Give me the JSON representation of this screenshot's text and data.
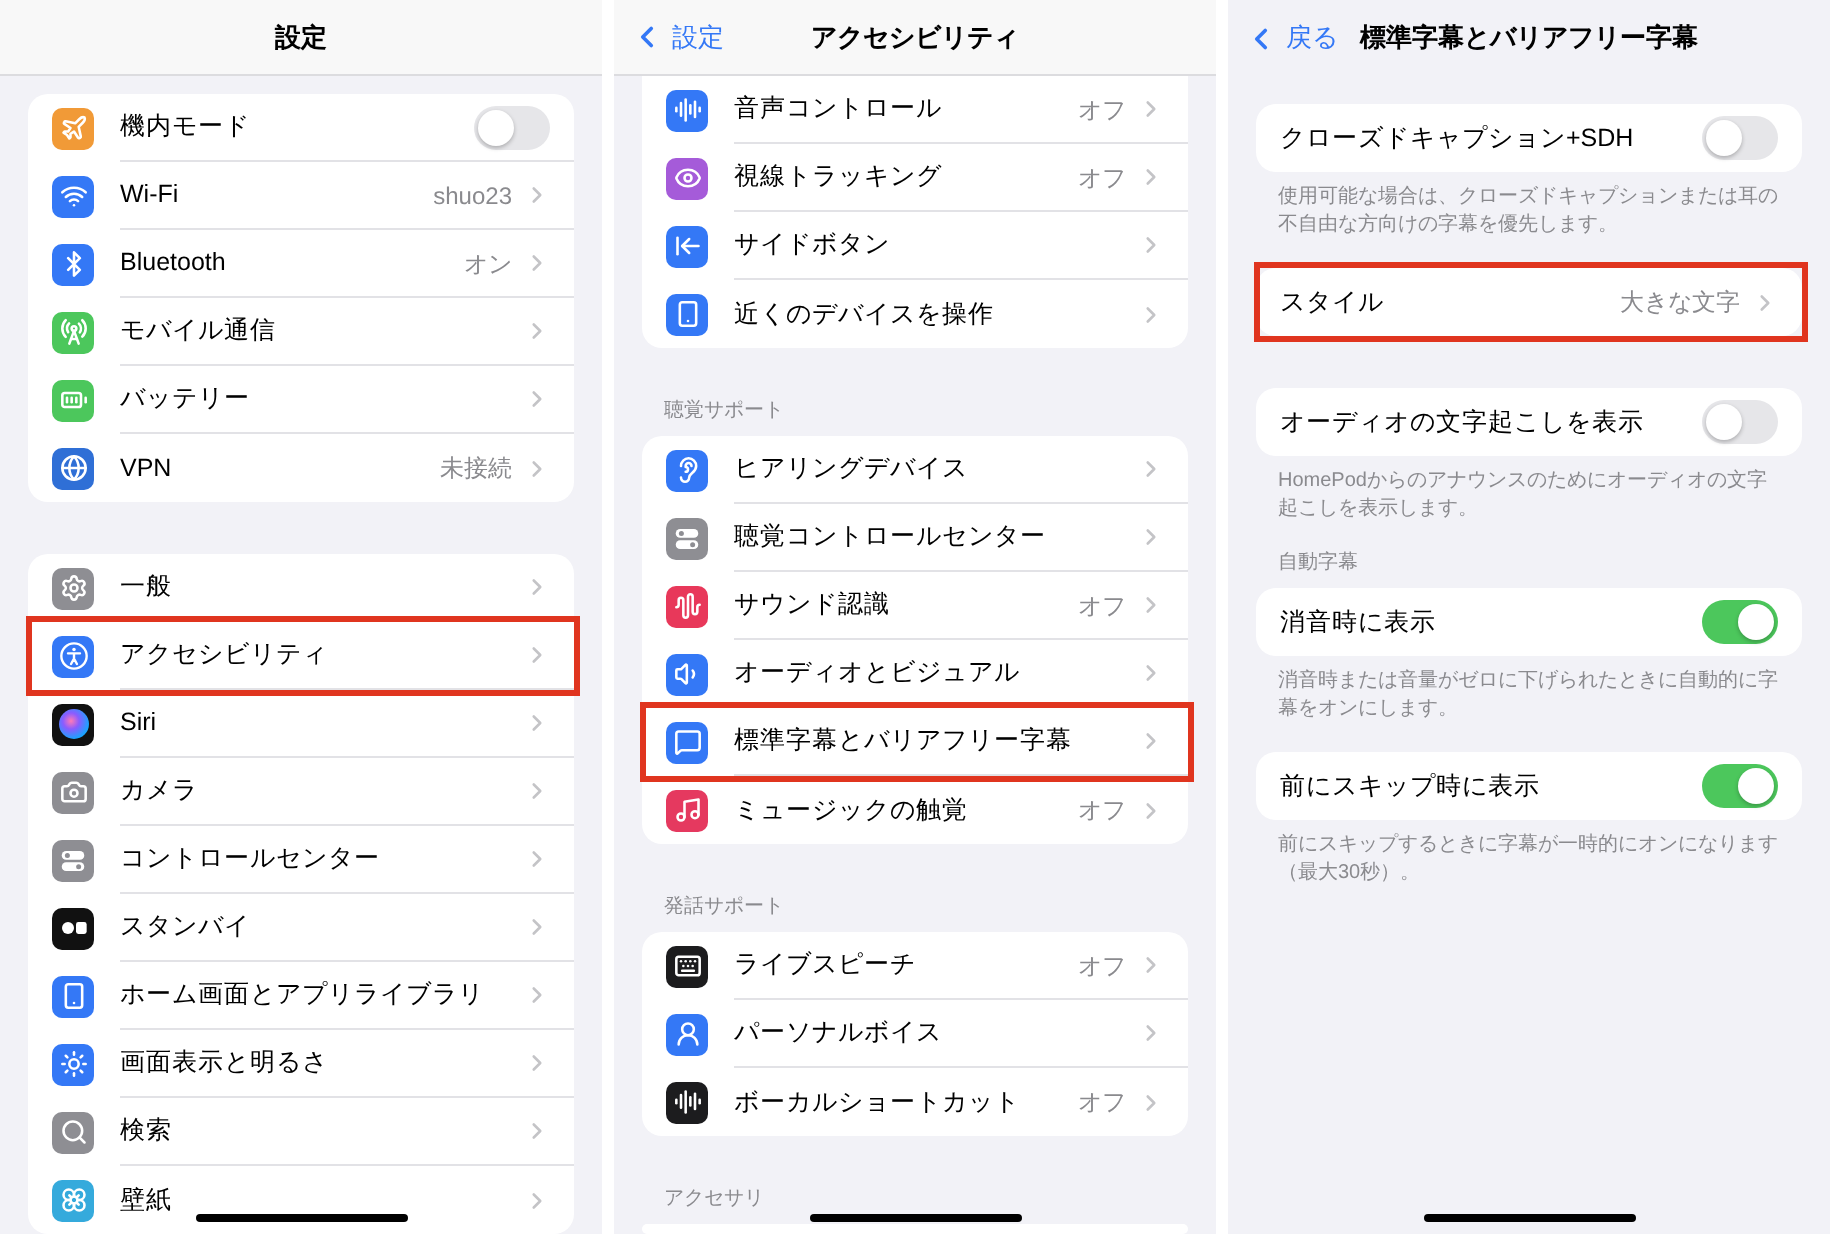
{
  "panels": [
    {
      "title": "設定",
      "scrolled": true,
      "groups": [
        {
          "rows": [
            {
              "label": "機内モード",
              "kind": "toggle",
              "on": false,
              "highlighted": false
            },
            {
              "label": "Wi-Fi",
              "kind": "link",
              "value": "shuo23",
              "highlighted": false
            },
            {
              "label": "Bluetooth",
              "kind": "link",
              "value": "オン",
              "highlighted": false
            },
            {
              "label": "モバイル通信",
              "kind": "link",
              "highlighted": false
            },
            {
              "label": "バッテリー",
              "kind": "link",
              "highlighted": false
            },
            {
              "label": "VPN",
              "kind": "link",
              "value": "未接続",
              "highlighted": false
            }
          ]
        },
        {
          "rows": [
            {
              "label": "一般",
              "kind": "link",
              "highlighted": false
            },
            {
              "label": "アクセシビリティ",
              "kind": "link",
              "highlighted": true
            },
            {
              "label": "Siri",
              "kind": "link",
              "highlighted": false
            },
            {
              "label": "カメラ",
              "kind": "link",
              "highlighted": false
            },
            {
              "label": "コントロールセンター",
              "kind": "link",
              "highlighted": false
            },
            {
              "label": "スタンバイ",
              "kind": "link",
              "highlighted": false
            },
            {
              "label": "ホーム画面とアプリライブラリ",
              "kind": "link",
              "highlighted": false
            },
            {
              "label": "画面表示と明るさ",
              "kind": "link",
              "highlighted": false
            },
            {
              "label": "検索",
              "kind": "link",
              "highlighted": false
            },
            {
              "label": "壁紙",
              "kind": "link",
              "highlighted": false
            }
          ]
        }
      ]
    },
    {
      "back": "設定",
      "title": "アクセシビリティ",
      "scrolled": true,
      "groups": [
        {
          "rows": [
            {
              "label": "音声コントロール",
              "kind": "link",
              "value": "オフ",
              "highlighted": false
            },
            {
              "label": "視線トラッキング",
              "kind": "link",
              "value": "オフ",
              "highlighted": false
            },
            {
              "label": "サイドボタン",
              "kind": "link",
              "highlighted": false
            },
            {
              "label": "近くのデバイスを操作",
              "kind": "link",
              "highlighted": false
            }
          ]
        },
        {
          "header": "聴覚サポート",
          "rows": [
            {
              "label": "ヒアリングデバイス",
              "kind": "link",
              "highlighted": false
            },
            {
              "label": "聴覚コントロールセンター",
              "kind": "link",
              "highlighted": false
            },
            {
              "label": "サウンド認識",
              "kind": "link",
              "value": "オフ",
              "highlighted": false
            },
            {
              "label": "オーディオとビジュアル",
              "kind": "link",
              "highlighted": false
            },
            {
              "label": "標準字幕とバリアフリー字幕",
              "kind": "link",
              "highlighted": true
            },
            {
              "label": "ミュージックの触覚",
              "kind": "link",
              "value": "オフ",
              "highlighted": false
            }
          ]
        },
        {
          "header": "発話サポート",
          "rows": [
            {
              "label": "ライブスピーチ",
              "kind": "link",
              "value": "オフ",
              "highlighted": false
            },
            {
              "label": "パーソナルボイス",
              "kind": "link",
              "highlighted": false
            },
            {
              "label": "ボーカルショートカット",
              "kind": "link",
              "value": "オフ",
              "highlighted": false
            }
          ]
        },
        {
          "header": "アクセサリ"
        }
      ]
    },
    {
      "back": "戻る",
      "title": "標準字幕とバリアフリー字幕",
      "scrolled": false,
      "groups": [
        {
          "rows": [
            {
              "label": "クローズドキャプション+SDH",
              "kind": "toggle",
              "on": false,
              "highlighted": false
            }
          ],
          "footer": "使用可能な場合は、クローズドキャプションまたは耳の不自由な方向けの字幕を優先します。"
        },
        {
          "rows": [
            {
              "label": "スタイル",
              "kind": "link",
              "value": "大きな文字",
              "highlighted": true
            }
          ]
        },
        {
          "rows": [
            {
              "label": "オーディオの文字起こしを表示",
              "kind": "toggle",
              "on": false,
              "highlighted": false
            }
          ],
          "footer": "HomePodからのアナウンスのためにオーディオの文字起こしを表示します。"
        },
        {
          "header": "自動字幕",
          "rows": [
            {
              "label": "消音時に表示",
              "kind": "toggle",
              "on": true,
              "highlighted": false
            }
          ],
          "footer": "消音時または音量がゼロに下げられたときに自動的に字幕をオンにします。"
        },
        {
          "rows": [
            {
              "label": "前にスキップ時に表示",
              "kind": "toggle",
              "on": true,
              "highlighted": false
            }
          ],
          "footer": "前にスキップするときに字幕が一時的にオンになります（最大30秒）。"
        }
      ]
    }
  ]
}
